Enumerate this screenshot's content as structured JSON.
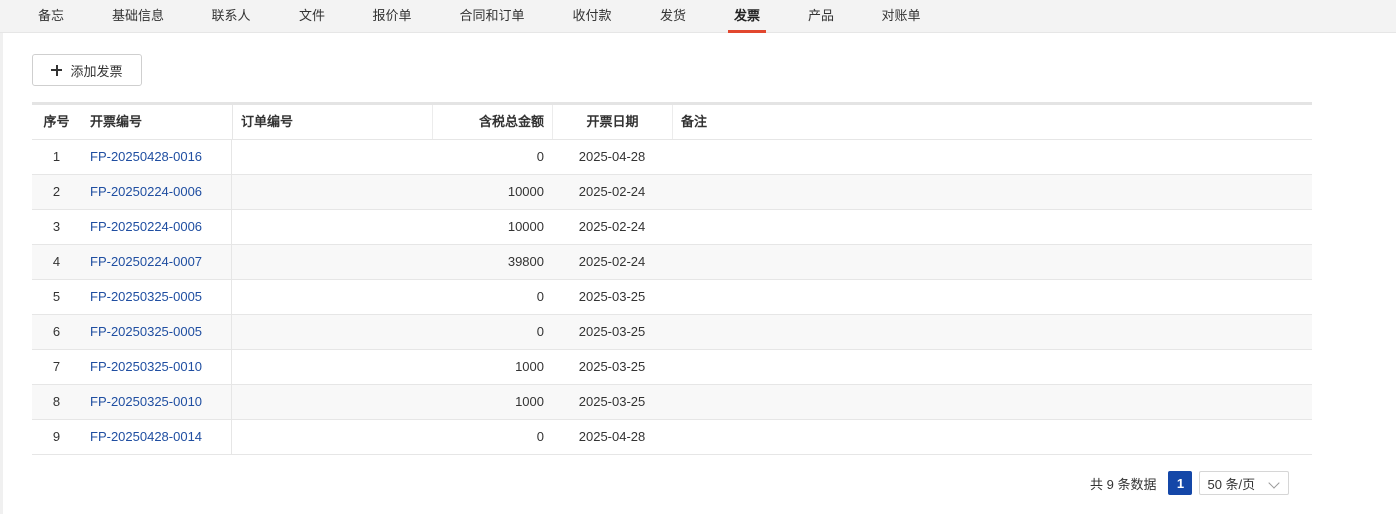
{
  "tabs": [
    {
      "label": "备忘",
      "active": false
    },
    {
      "label": "基础信息",
      "active": false
    },
    {
      "label": "联系人",
      "active": false
    },
    {
      "label": "文件",
      "active": false
    },
    {
      "label": "报价单",
      "active": false
    },
    {
      "label": "合同和订单",
      "active": false
    },
    {
      "label": "收付款",
      "active": false
    },
    {
      "label": "发货",
      "active": false
    },
    {
      "label": "发票",
      "active": true
    },
    {
      "label": "产品",
      "active": false
    },
    {
      "label": "对账单",
      "active": false
    }
  ],
  "toolbar": {
    "add_label": "添加发票"
  },
  "table": {
    "columns": {
      "idx": "序号",
      "invoice_no": "开票编号",
      "order_no": "订单编号",
      "amount": "含税总金额",
      "date": "开票日期",
      "note": "备注"
    },
    "rows": [
      {
        "idx": "1",
        "invoice_no": "FP-20250428-0016",
        "order_no": "",
        "amount": "0",
        "date": "2025-04-28",
        "note": ""
      },
      {
        "idx": "2",
        "invoice_no": "FP-20250224-0006",
        "order_no": "",
        "amount": "10000",
        "date": "2025-02-24",
        "note": ""
      },
      {
        "idx": "3",
        "invoice_no": "FP-20250224-0006",
        "order_no": "",
        "amount": "10000",
        "date": "2025-02-24",
        "note": ""
      },
      {
        "idx": "4",
        "invoice_no": "FP-20250224-0007",
        "order_no": "",
        "amount": "39800",
        "date": "2025-02-24",
        "note": ""
      },
      {
        "idx": "5",
        "invoice_no": "FP-20250325-0005",
        "order_no": "",
        "amount": "0",
        "date": "2025-03-25",
        "note": ""
      },
      {
        "idx": "6",
        "invoice_no": "FP-20250325-0005",
        "order_no": "",
        "amount": "0",
        "date": "2025-03-25",
        "note": ""
      },
      {
        "idx": "7",
        "invoice_no": "FP-20250325-0010",
        "order_no": "",
        "amount": "1000",
        "date": "2025-03-25",
        "note": ""
      },
      {
        "idx": "8",
        "invoice_no": "FP-20250325-0010",
        "order_no": "",
        "amount": "1000",
        "date": "2025-03-25",
        "note": ""
      },
      {
        "idx": "9",
        "invoice_no": "FP-20250428-0014",
        "order_no": "",
        "amount": "0",
        "date": "2025-04-28",
        "note": ""
      }
    ]
  },
  "pagination": {
    "total_text": "共 9 条数据",
    "current_page": "1",
    "page_size": "50 条/页"
  },
  "colors": {
    "accent": "#e2472f",
    "link": "#1f4ea1",
    "page_active": "#1447a8"
  }
}
